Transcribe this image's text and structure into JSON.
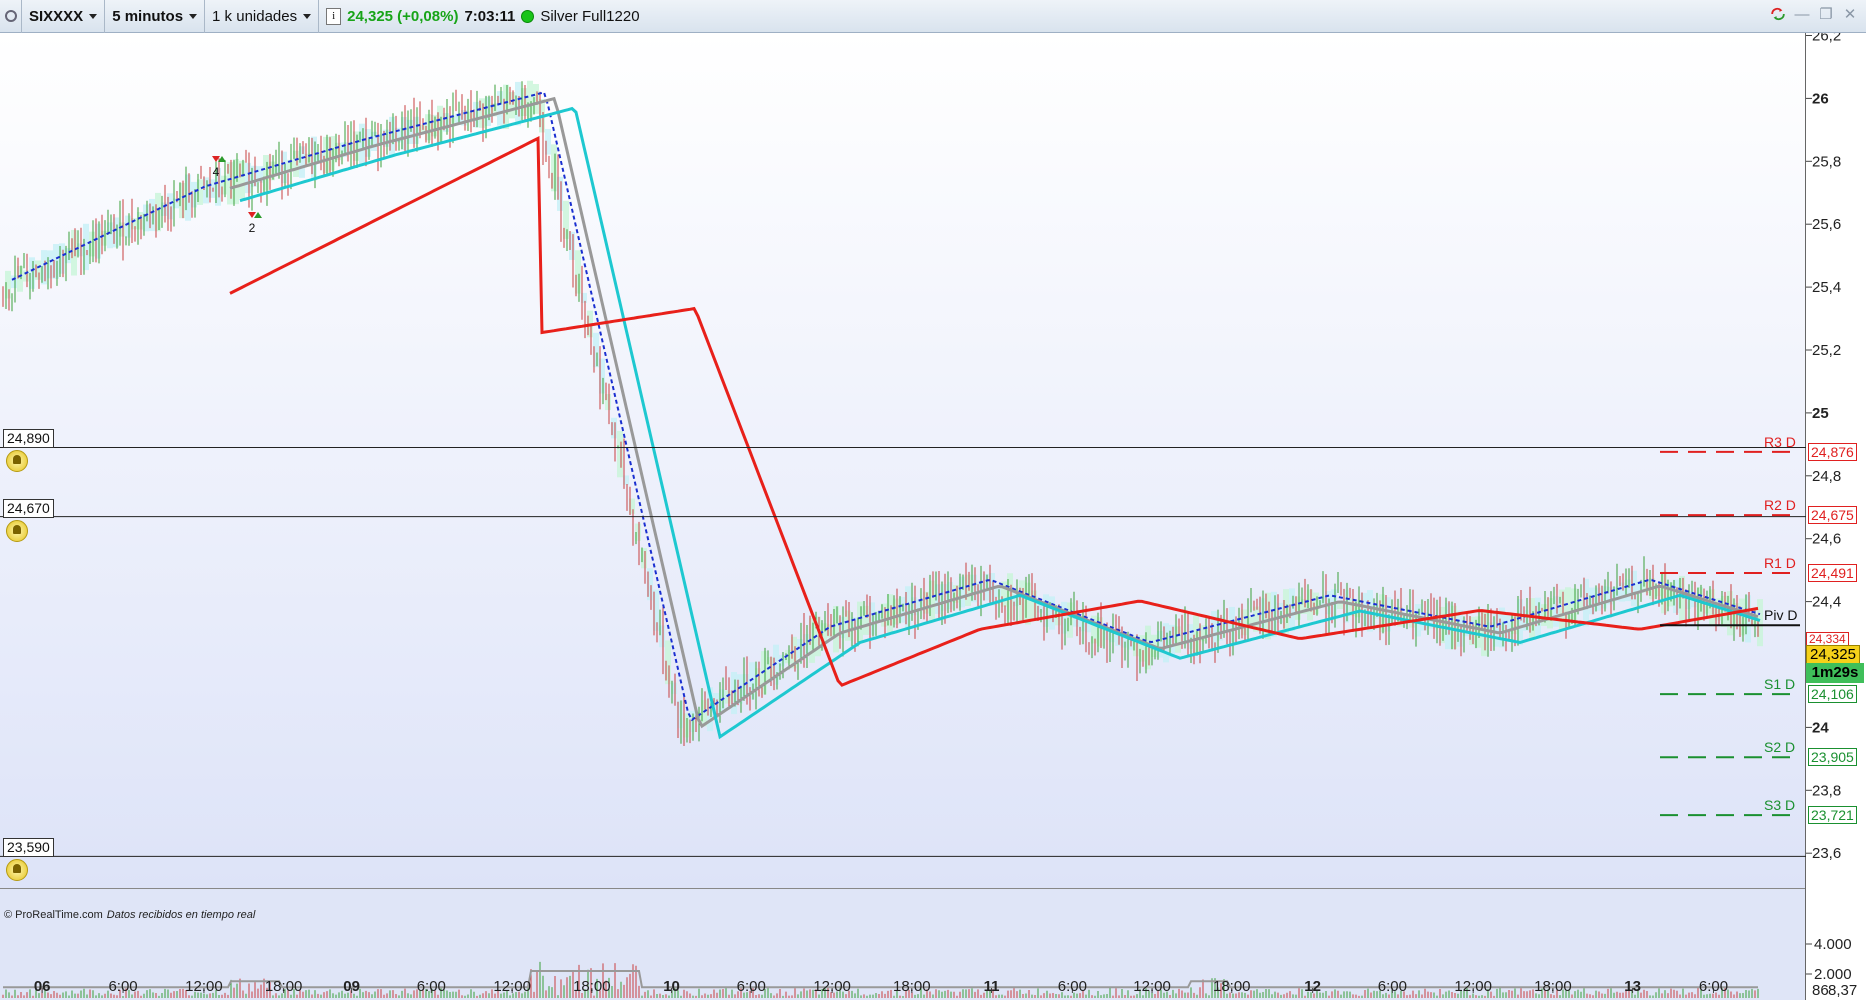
{
  "toolbar": {
    "symbol": "SIXXXX",
    "timeframe": "5 minutos",
    "units": "1 k unidades",
    "info_icon_label": "i",
    "last_price": "24,325 (+0,08%)",
    "time": "7:03:11",
    "account": "Silver Full1220"
  },
  "window_controls": [
    "sync-icon",
    "minimize-icon",
    "restore-icon",
    "close-icon"
  ],
  "colors": {
    "ma_red": "#e8201a",
    "ma_cyan": "#1ec8d0",
    "ma_gray": "#999999",
    "dashed_blue": "#1a2fd0",
    "resistance": "#e02020",
    "support": "#1a9030",
    "candle_up": "#3aa03a",
    "candle_down": "#c84040"
  },
  "price_axis": {
    "ticks": [
      "26,2",
      "26",
      "25,8",
      "25,6",
      "25,4",
      "25,2",
      "25",
      "24,8",
      "24,6",
      "24,4",
      "24,2",
      "24",
      "23,8",
      "23,6"
    ],
    "bold_ticks": [
      "26",
      "25",
      "24"
    ]
  },
  "price_scale": {
    "min": 23.5,
    "max": 26.2
  },
  "time_axis": [
    "06",
    "6:00",
    "12:00",
    "18:00",
    "09",
    "6:00",
    "12:00",
    "18:00",
    "10",
    "6:00",
    "12:00",
    "18:00",
    "11",
    "6:00",
    "12:00",
    "18:00",
    "12",
    "6:00",
    "12:00",
    "18:00",
    "13",
    "6:00"
  ],
  "bold_time_labels": [
    "06",
    "09",
    "10",
    "11",
    "12",
    "13"
  ],
  "alert_levels": [
    {
      "label": "24,890",
      "value": 24.89
    },
    {
      "label": "24,670",
      "value": 24.67
    },
    {
      "label": "23,590",
      "value": 23.59
    }
  ],
  "pivots": [
    {
      "name": "R3 D",
      "label": "24,876",
      "value": 24.876,
      "kind": "resistance"
    },
    {
      "name": "R2 D",
      "label": "24,675",
      "value": 24.675,
      "kind": "resistance"
    },
    {
      "name": "R1 D",
      "label": "24,491",
      "value": 24.491,
      "kind": "resistance"
    },
    {
      "name": "Piv D",
      "label": "24,325",
      "value": 24.325,
      "kind": "pivot"
    },
    {
      "name": "S1 D",
      "label": "24,106",
      "value": 24.106,
      "kind": "support"
    },
    {
      "name": "S2 D",
      "label": "23,905",
      "value": 23.905,
      "kind": "support"
    },
    {
      "name": "S3 D",
      "label": "23,721",
      "value": 23.721,
      "kind": "support"
    }
  ],
  "overlay_price_label": "24,334",
  "current_price_label": "24,325",
  "countdown": "1m29s",
  "credit": {
    "site": "© ProRealTime.com",
    "note": "Datos recibidos en tiempo real"
  },
  "volume_axis": [
    "4.000",
    "2.000"
  ],
  "volume_tag": "86",
  "volume_tag2": "8,37",
  "order_markers": [
    "4",
    "2"
  ],
  "chart_data": {
    "type": "line",
    "x": [
      "06 00:00",
      "06 12:00",
      "09 00:00",
      "09 12:00",
      "10 00:00",
      "10 12:00",
      "11 00:00",
      "11 12:00",
      "12 00:00",
      "12 12:00",
      "13 00:00",
      "13 06:00"
    ],
    "series": [
      {
        "values": [
          25.4,
          25.7,
          25.85,
          26.0,
          24.0,
          24.3,
          24.45,
          24.25,
          24.4,
          24.3,
          24.45,
          24.33
        ]
      }
    ],
    "ylim": [
      23.5,
      26.2
    ]
  }
}
